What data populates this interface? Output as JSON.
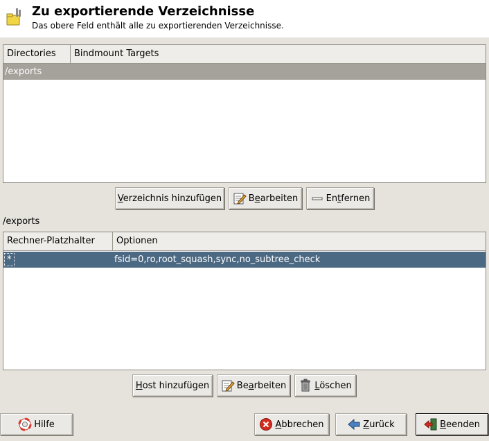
{
  "header": {
    "title": "Zu exportierende Verzeichnisse",
    "subtitle": "Das obere Feld enthält alle zu exportierenden Verzeichnisse.",
    "icon": "folder-export-icon"
  },
  "directories_table": {
    "columns": [
      "Directories",
      "Bindmount Targets"
    ],
    "rows": [
      {
        "directory": "/exports",
        "bindmount": ""
      }
    ]
  },
  "directory_buttons": {
    "add": {
      "pre": "",
      "u": "V",
      "post": "erzeichnis hinzufügen"
    },
    "edit": {
      "pre": "B",
      "u": "e",
      "post": "arbeiten"
    },
    "remove": {
      "pre": "En",
      "u": "t",
      "post": "fernen"
    }
  },
  "selected_path": "/exports",
  "hosts_table": {
    "columns": [
      "Rechner-Platzhalter",
      "Optionen"
    ],
    "rows": [
      {
        "host": "*",
        "options": "fsid=0,ro,root_squash,sync,no_subtree_check"
      }
    ]
  },
  "host_buttons": {
    "add": {
      "pre": "",
      "u": "H",
      "post": "ost hinzufügen"
    },
    "edit": {
      "pre": "Be",
      "u": "a",
      "post": "rbeiten"
    },
    "delete": {
      "pre": "",
      "u": "L",
      "post": "öschen"
    }
  },
  "footer": {
    "help": "Hilfe",
    "cancel": {
      "pre": "",
      "u": "A",
      "post": "bbrechen"
    },
    "back": {
      "pre": "",
      "u": "Z",
      "post": "urück"
    },
    "finish": {
      "pre": "",
      "u": "B",
      "post": "eenden"
    }
  },
  "colors": {
    "selection_gray": "#a5a19b",
    "selection_blue": "#4b6983",
    "window_bg": "#e6e3dd"
  }
}
